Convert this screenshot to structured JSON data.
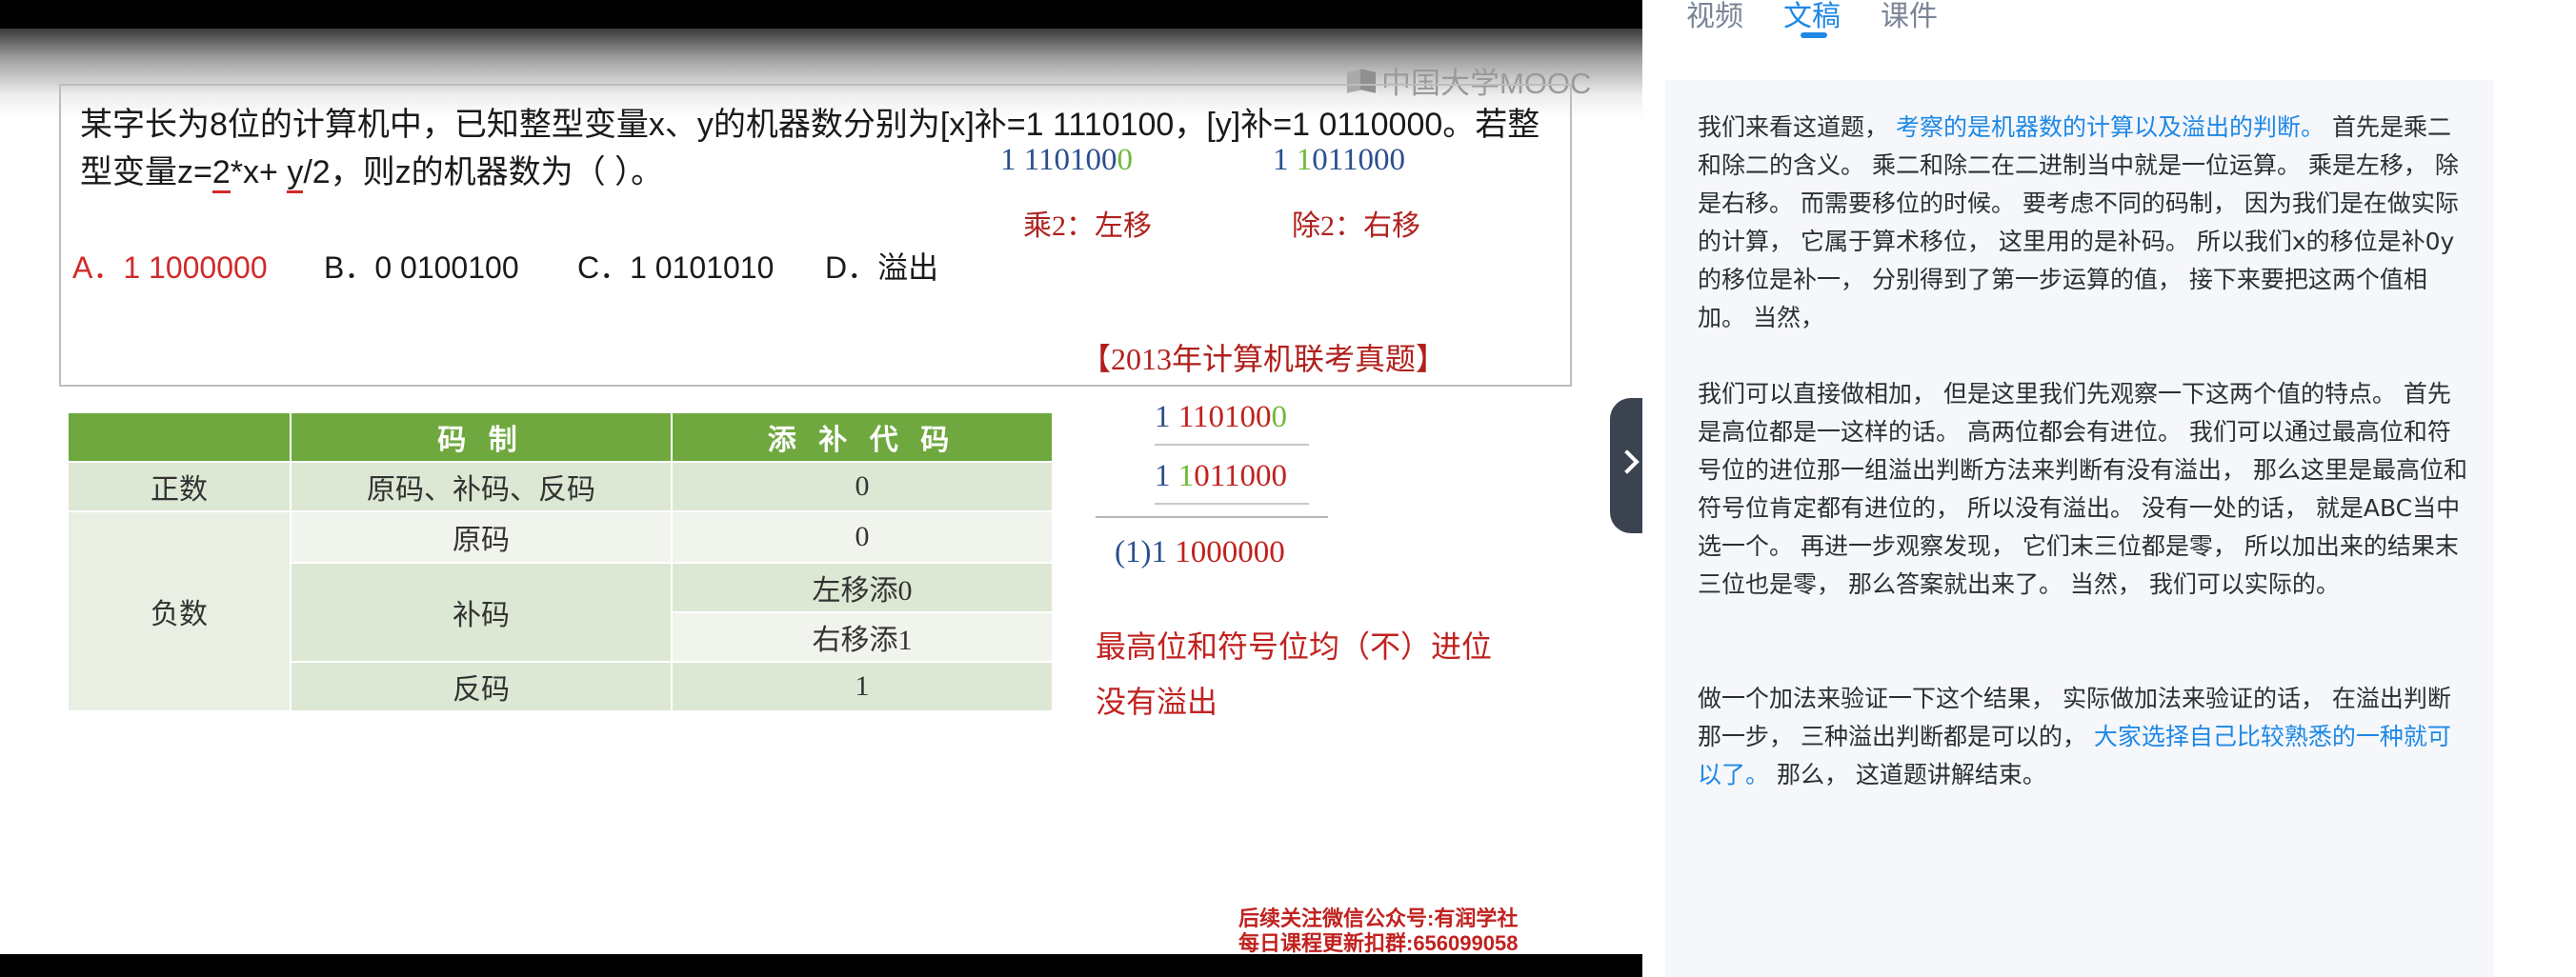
{
  "video": {
    "logo_text": "中国大学MOOC",
    "question": {
      "line1": "某字长为8位的计算机中，已知整型变量x、y的机器数分别为[x]补=1 1110100，[y]补=1 0110000。若整",
      "line2_pre": "型变量z=",
      "line2_u1": "2",
      "line2_mid": "*x+ ",
      "line2_u2": "y",
      "line2_post": "/2，则z的机器数为（      ）。"
    },
    "calc_x": {
      "prefix": "1 110100",
      "last": "0"
    },
    "calc_y": {
      "first": "1 ",
      "green": "1",
      "rest": "011000"
    },
    "shift_left_label": "乘2：左移",
    "shift_right_label": "除2：右移",
    "choices": {
      "a": "A．1 1000000",
      "b": "B．0 0100100",
      "c": "C．1 0101010",
      "d": "D．溢出"
    },
    "exam_tag": "【2013年计算机联考真题】",
    "table": {
      "headers": [
        "",
        "码  制",
        "添 补 代 码"
      ],
      "positive_label": "正数",
      "positive_codes": "原码、补码、反码",
      "positive_fill": "0",
      "negative_label": "负数",
      "neg_original": "原码",
      "neg_original_fill": "0",
      "neg_complement": "补码",
      "neg_complement_left": "左移添0",
      "neg_complement_right": "右移添1",
      "neg_ones": "反码",
      "neg_ones_fill": "1"
    },
    "sum": {
      "row1_a": "1 ",
      "row1_b": "110100",
      "row1_c": "0",
      "row2_a": "1 ",
      "row2_b": "1",
      "row2_c": "011000",
      "result_a": "(1)",
      "result_b": "1 ",
      "result_c": "1000000"
    },
    "note_line1": "最高位和符号位均（不）进位",
    "note_line2": "没有溢出",
    "footer_line1": "后续关注微信公众号:有润学社",
    "footer_line2": "每日课程更新扣群:656099058"
  },
  "panel": {
    "tabs": [
      "视频",
      "文稿",
      "课件"
    ],
    "active_tab": "文稿",
    "paragraphs": {
      "p1_a": "我们来看这道题，",
      "p1_hl": "考察的是机器数的计算以及溢出的判断。",
      "p1_b": "首先是乘二和除二的含义。 乘二和除二在二进制当中就是一位运算。 乘是左移， 除是右移。 而需要移位的时候。 要考虑不同的码制， 因为我们是在做实际的计算， 它属于算术移位， 这里用的是补码。 所以我们x的移位是补0y的移位是补一， 分别得到了第一步运算的值， 接下来要把这两个值相加。 当然，",
      "p2": "我们可以直接做相加， 但是这里我们先观察一下这两个值的特点。 首先是高位都是一这样的话。 高两位都会有进位。 我们可以通过最高位和符号位的进位那一组溢出判断方法来判断有没有溢出， 那么这里是最高位和符号位肯定都有进位的， 所以没有溢出。 没有一处的话， 就是ABC当中选一个。 再进一步观察发现， 它们末三位都是零， 所以加出来的结果末三位也是零， 那么答案就出来了。 当然， 我们可以实际的。",
      "p3_a": "做一个加法来验证一下这个结果， 实际做加法来验证的话， 在溢出判断那一步， 三种溢出判断都是可以的，",
      "p3_hl": "大家选择自己比较熟悉的一种就可以了。",
      "p3_b": "那么， 这道题讲解结束。"
    }
  }
}
